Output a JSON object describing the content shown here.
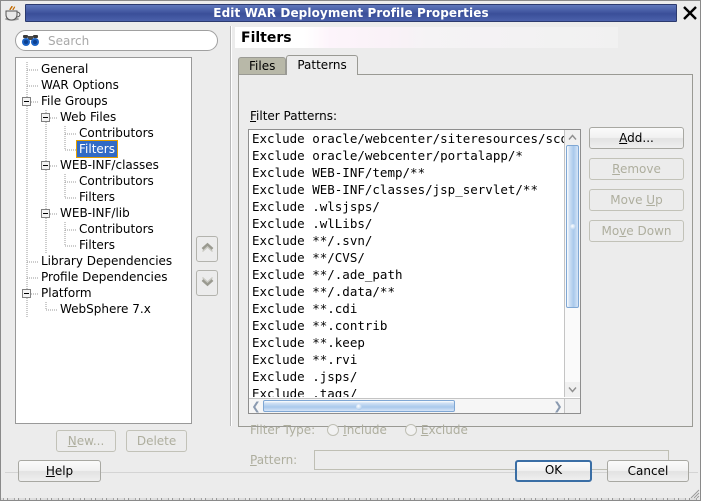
{
  "window": {
    "title": "Edit WAR Deployment Profile Properties",
    "app_icon": "java-coffee-cup-icon",
    "close_label": "✕"
  },
  "sidebar": {
    "search": {
      "placeholder": "Search",
      "value": "",
      "icon": "binoculars-icon"
    },
    "tree": [
      {
        "label": "General",
        "depth": 1,
        "toggle": "none",
        "selected": false
      },
      {
        "label": "WAR Options",
        "depth": 1,
        "toggle": "none",
        "selected": false
      },
      {
        "label": "File Groups",
        "depth": 1,
        "toggle": "expanded",
        "selected": false
      },
      {
        "label": "Web Files",
        "depth": 2,
        "toggle": "expanded",
        "selected": false
      },
      {
        "label": "Contributors",
        "depth": 3,
        "toggle": "none",
        "selected": false
      },
      {
        "label": "Filters",
        "depth": 3,
        "toggle": "none",
        "selected": true
      },
      {
        "label": "WEB-INF/classes",
        "depth": 2,
        "toggle": "expanded",
        "selected": false
      },
      {
        "label": "Contributors",
        "depth": 3,
        "toggle": "none",
        "selected": false
      },
      {
        "label": "Filters",
        "depth": 3,
        "toggle": "none",
        "selected": false
      },
      {
        "label": "WEB-INF/lib",
        "depth": 2,
        "toggle": "expanded",
        "selected": false
      },
      {
        "label": "Contributors",
        "depth": 3,
        "toggle": "none",
        "selected": false
      },
      {
        "label": "Filters",
        "depth": 3,
        "toggle": "none",
        "selected": false
      },
      {
        "label": "Library Dependencies",
        "depth": 1,
        "toggle": "none",
        "selected": false
      },
      {
        "label": "Profile Dependencies",
        "depth": 1,
        "toggle": "none",
        "selected": false
      },
      {
        "label": "Platform",
        "depth": 1,
        "toggle": "expanded",
        "selected": false
      },
      {
        "label": "WebSphere 7.x",
        "depth": 2,
        "toggle": "none",
        "selected": false
      }
    ],
    "reorder": {
      "up_icon": "chevron-up-icon",
      "down_icon": "chevron-down-icon"
    },
    "new_label": "New...",
    "new_mnemonic": "N",
    "delete_label": "Delete",
    "delete_mnemonic": "t",
    "new_enabled": false,
    "delete_enabled": false
  },
  "main": {
    "section_title": "Filters",
    "tabs": [
      {
        "label": "Files",
        "active": false
      },
      {
        "label": "Patterns",
        "active": true
      }
    ],
    "filter_patterns_label": "Filter Patterns:",
    "filter_patterns_mnemonic": "F",
    "patterns": [
      "Exclude oracle/webcenter/siteresources/scoped",
      "Exclude oracle/webcenter/portalapp/*",
      "Exclude WEB-INF/temp/**",
      "Exclude WEB-INF/classes/jsp_servlet/**",
      "Exclude .wlsjsps/",
      "Exclude .wlLibs/",
      "Exclude **/.svn/",
      "Exclude **/CVS/",
      "Exclude **/.ade_path",
      "Exclude **/.data/**",
      "Exclude **.cdi",
      "Exclude **.contrib",
      "Exclude **.keep",
      "Exclude **.rvi",
      "Exclude .jsps/",
      "Exclude .tags/"
    ],
    "side_buttons": [
      {
        "label": "Add...",
        "mnemonic": "A",
        "enabled": true
      },
      {
        "label": "Remove",
        "mnemonic": "R",
        "enabled": false
      },
      {
        "label": "Move Up",
        "mnemonic": "U",
        "enabled": false
      },
      {
        "label": "Move Down",
        "mnemonic": "v",
        "enabled": false
      }
    ],
    "filter_type_label": "Filter Type:",
    "filter_type_options": [
      {
        "label": "Include",
        "mnemonic": "I",
        "selected": false
      },
      {
        "label": "Exclude",
        "mnemonic": "E",
        "selected": false
      }
    ],
    "pattern_label": "Pattern:",
    "pattern_mnemonic": "P",
    "pattern_value": "",
    "pattern_enabled": false
  },
  "footer": {
    "help_label": "Help",
    "help_mnemonic": "H",
    "ok_label": "OK",
    "cancel_label": "Cancel"
  },
  "colors": {
    "titlebar_blue": "#41569f",
    "selection_blue": "#316ac5",
    "selection_focus": "#e5a100",
    "panel_bg": "#ececec",
    "disabled_text": "#aeae9e",
    "tab_inactive": "#b8b8a8",
    "ok_focus_border": "#3a6ea5"
  }
}
